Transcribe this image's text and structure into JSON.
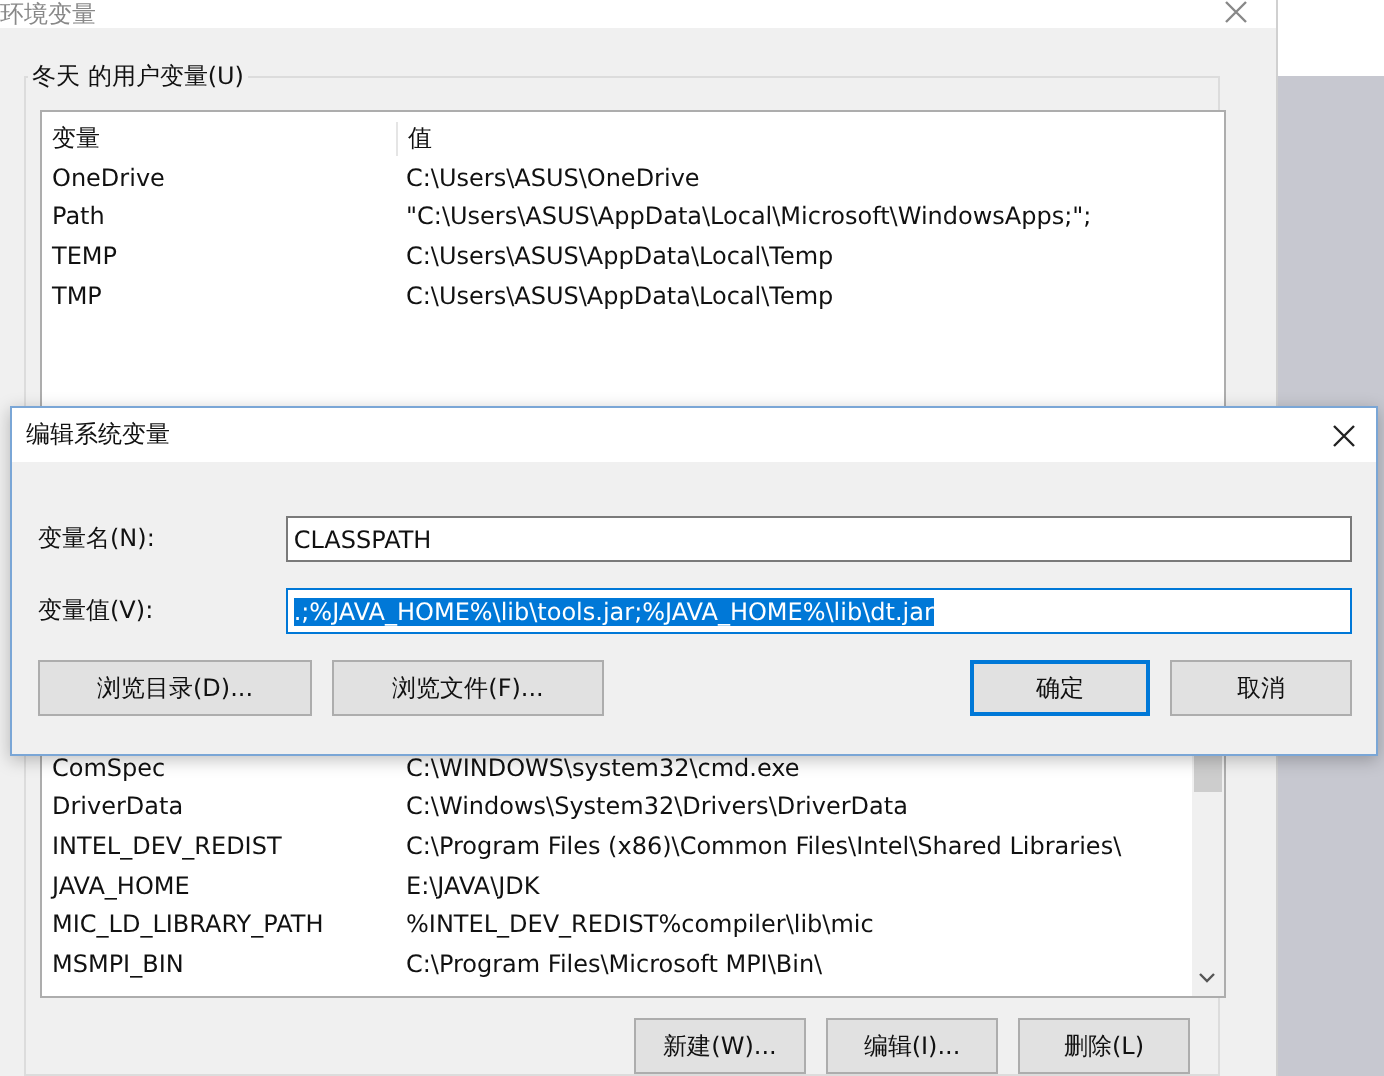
{
  "window": {
    "title": "环境变量"
  },
  "user_variables": {
    "label": "冬天 的用户变量(U)",
    "columns": [
      "变量",
      "值"
    ],
    "rows": [
      {
        "name": "OneDrive",
        "value": "C:\\Users\\ASUS\\OneDrive"
      },
      {
        "name": "Path",
        "value": "\"C:\\Users\\ASUS\\AppData\\Local\\Microsoft\\WindowsApps;\";"
      },
      {
        "name": "TEMP",
        "value": "C:\\Users\\ASUS\\AppData\\Local\\Temp"
      },
      {
        "name": "TMP",
        "value": "C:\\Users\\ASUS\\AppData\\Local\\Temp"
      }
    ]
  },
  "edit_dialog": {
    "title": "编辑系统变量",
    "fields": [
      {
        "label": "变量名(N):",
        "value": "CLASSPATH",
        "selected": false
      },
      {
        "label": "变量值(V):",
        "value": ".;%JAVA_HOME%\\lib\\tools.jar;%JAVA_HOME%\\lib\\dt.jar",
        "selected": true
      }
    ],
    "buttons": [
      {
        "label": "浏览目录(D)...",
        "default": false
      },
      {
        "label": "浏览文件(F)...",
        "default": false
      },
      {
        "label": "确定",
        "default": true
      },
      {
        "label": "取消",
        "default": false
      }
    ]
  },
  "system_variables": {
    "rows": [
      {
        "name": "ComSpec",
        "value": "C:\\WINDOWS\\system32\\cmd.exe"
      },
      {
        "name": "DriverData",
        "value": "C:\\Windows\\System32\\Drivers\\DriverData"
      },
      {
        "name": "INTEL_DEV_REDIST",
        "value": "C:\\Program Files (x86)\\Common Files\\Intel\\Shared Libraries\\"
      },
      {
        "name": "JAVA_HOME",
        "value": "E:\\JAVA\\JDK"
      },
      {
        "name": "MIC_LD_LIBRARY_PATH",
        "value": "%INTEL_DEV_REDIST%compiler\\lib\\mic"
      },
      {
        "name": "MSMPI_BIN",
        "value": "C:\\Program Files\\Microsoft MPI\\Bin\\"
      }
    ],
    "buttons": [
      "新建(W)...",
      "编辑(I)...",
      "删除(L)"
    ]
  }
}
